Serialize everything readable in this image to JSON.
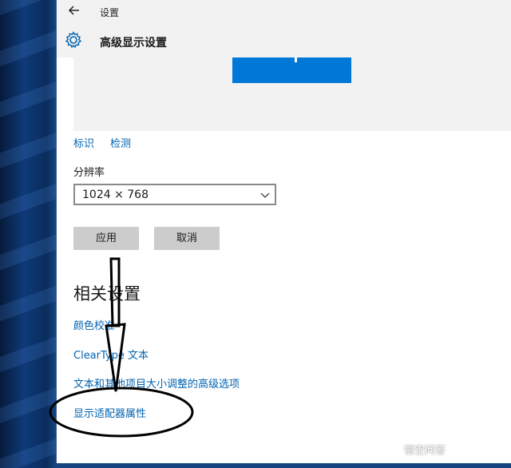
{
  "window": {
    "title": "设置",
    "page_title": "高级显示设置"
  },
  "display": {
    "identify_link": "标识",
    "detect_link": "检测",
    "resolution_label": "分辨率",
    "resolution_value": "1024 × 768"
  },
  "actions": {
    "apply": "应用",
    "cancel": "取消"
  },
  "related": {
    "title": "相关设置",
    "links": [
      "颜色校准",
      "ClearType 文本",
      "文本和其他项目大小调整的高级选项",
      "显示适配器属性"
    ]
  },
  "watermark": {
    "text": "悟空问答"
  },
  "colors": {
    "accent": "#0078d7",
    "link": "#0063b1",
    "button": "#cccccc",
    "header_bg": "#f2f2f2"
  },
  "icons": {
    "back": "arrow-left-icon",
    "settings": "gear-icon",
    "dropdown": "chevron-down-icon"
  }
}
